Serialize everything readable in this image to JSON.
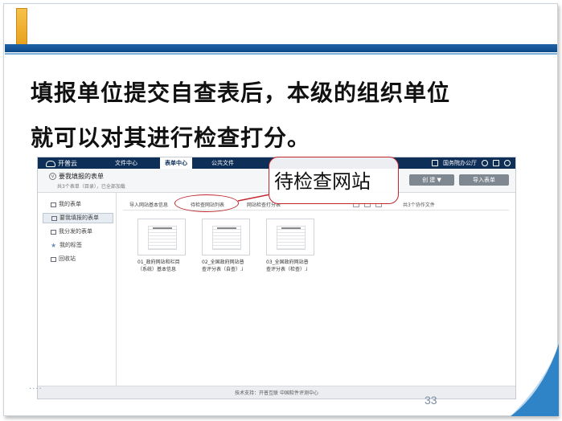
{
  "slide": {
    "line1": "填报单位提交自查表后，本级的组织单位",
    "line2": "就可以对其进行检查打分。",
    "page_number": "33",
    "dots": "....",
    "callout": "待检查网站"
  },
  "app": {
    "logo": "开普云",
    "nav_tabs": [
      "文件中心",
      "表单中心",
      "公共文件"
    ],
    "active_tab": "表单中心",
    "nav_right_label": "国务院办公厅",
    "header_title": "要我填报的表单",
    "header_sub": "共3个表单（目录），已全部加载",
    "btn_create": "创 建 ▼",
    "btn_import": "导入表单",
    "sidebar": [
      "我的表单",
      "要我填报的表单",
      "我分发的表单",
      "我的标签",
      "回收站"
    ],
    "sidebar_active": "要我填报的表单",
    "toolbar_tabs": [
      "导入网站基本信息",
      "待检查网站列表",
      "网站检查打分表"
    ],
    "file_count": "共3个协作文件",
    "files": [
      {
        "line1": "01_政府网站和栏目",
        "line2": "（系统）基本信息"
      },
      {
        "line1": "02_全国政府网站普",
        "line2": "查评分表（自查）.i"
      },
      {
        "line1": "03_全国政府网站普",
        "line2": "查评分表（检查）.i"
      }
    ],
    "footer": "技术支持：开普互联  中国软件评测中心"
  }
}
